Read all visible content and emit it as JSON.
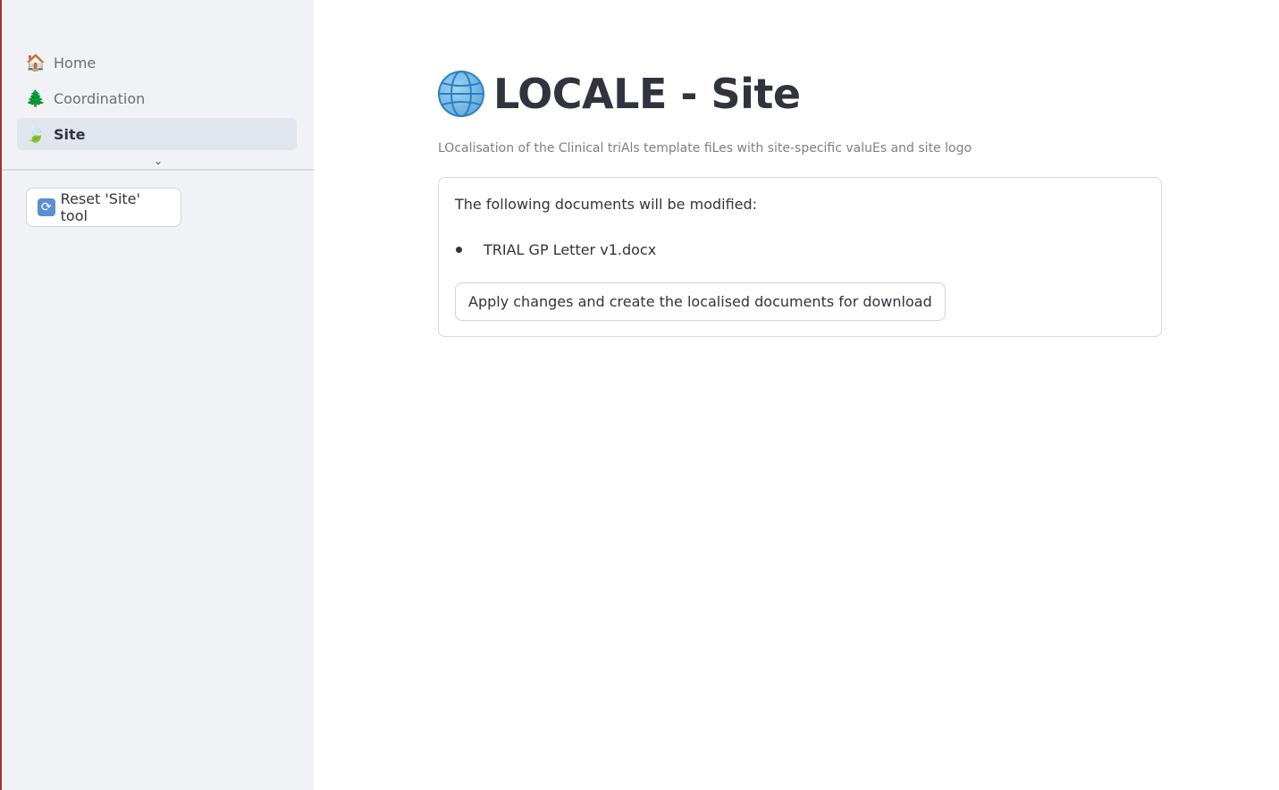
{
  "sidebar": {
    "items": [
      {
        "label": "Home",
        "icon": "house-icon"
      },
      {
        "label": "Coordination",
        "icon": "tree-icon"
      },
      {
        "label": "Site",
        "icon": "leaf-icon",
        "active": true
      }
    ],
    "reset_label": "Reset 'Site' tool"
  },
  "main": {
    "title": "LOCALE - Site",
    "subtitle": "LOcalisation of the Clinical triAls template fiLes with site-specific valuEs and site logo",
    "card": {
      "intro": "The following documents will be modified:",
      "documents": [
        "TRIAL GP Letter v1.docx"
      ],
      "apply_label": "Apply changes and create the localised documents for download"
    }
  }
}
